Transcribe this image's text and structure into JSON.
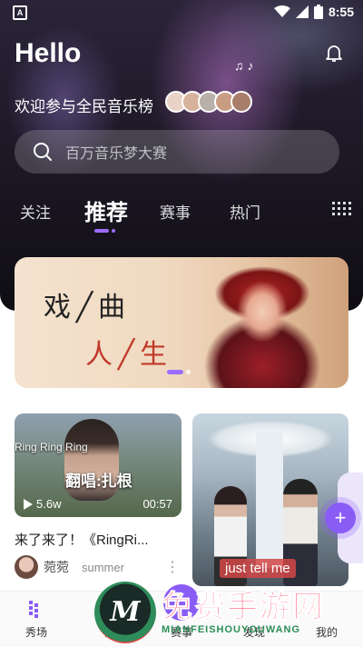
{
  "status_bar": {
    "time": "8:55",
    "app_indicator": "A"
  },
  "header": {
    "greeting": "Hello",
    "subtitle": "欢迎参与全民音乐榜",
    "avatar_colors": [
      "#e9d3c7",
      "#d7b39d",
      "#b9b0aa",
      "#c99d84",
      "#a87d6a"
    ]
  },
  "search": {
    "placeholder": "百万音乐梦大赛"
  },
  "tabs": [
    {
      "label": "关注",
      "active": false
    },
    {
      "label": "推荐",
      "active": true
    },
    {
      "label": "赛事",
      "active": false
    },
    {
      "label": "热门",
      "active": false
    }
  ],
  "banner": {
    "line1": "戏╱曲",
    "line2": "人╱生"
  },
  "cards": [
    {
      "song_overlay": "Ring Ring Ring",
      "caption": "翻唱:扎根",
      "plays": "5.6w",
      "duration": "00:57",
      "title": "来了来了！《RingRi...",
      "user": "菀菀",
      "handle": "summer"
    },
    {
      "lyric": "just tell me"
    }
  ],
  "bottom_nav": [
    {
      "label": "秀场"
    },
    {
      "label": "榜"
    },
    {
      "label": "赛事"
    },
    {
      "label": "发现"
    },
    {
      "label": "我的"
    }
  ],
  "watermark": {
    "brand": "免费手游网",
    "pinyin": "MIANFEISHOUYOUWANG",
    "logo_letter": "M"
  },
  "colors": {
    "accent": "#8a5cf6",
    "hero_bg": "#1b1724",
    "watermark_red": "#ff2c55",
    "watermark_green": "#2a8f56"
  },
  "icons": [
    "wifi-icon",
    "signal-icon",
    "battery-icon",
    "bell-icon",
    "music-note-icon",
    "search-icon",
    "grid-menu-icon",
    "play-icon",
    "more-icon",
    "plus-icon"
  ]
}
